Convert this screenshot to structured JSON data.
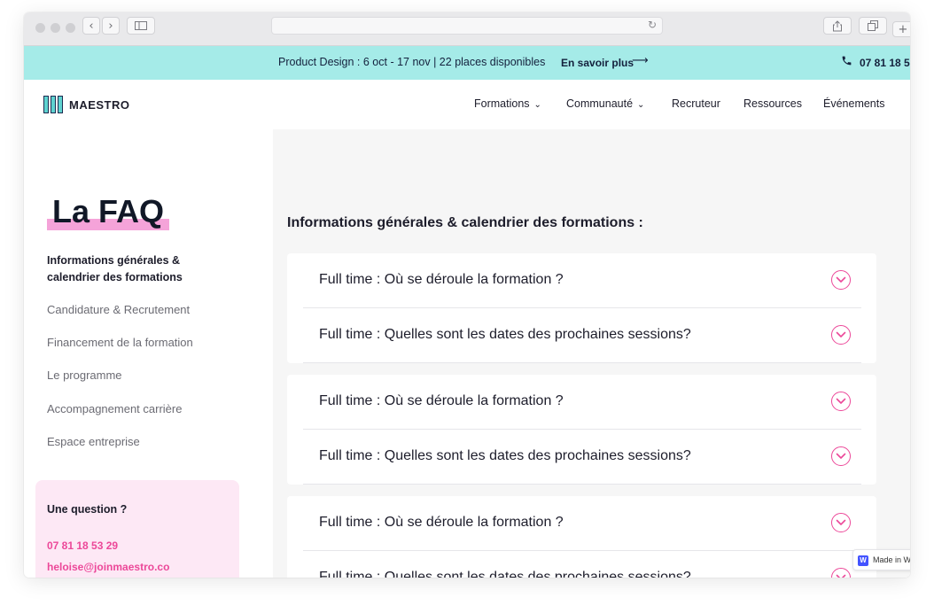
{
  "browser": {
    "reload_icon": "↻"
  },
  "promo_bar": {
    "text": "Product Design : 6 oct - 17 nov | 22 places disponibles",
    "link": "En savoir plus",
    "arrow": "⟶",
    "phone_icon": "phone-icon",
    "phone": "07 81 18 5"
  },
  "nav": {
    "logo": "MAESTRO",
    "items": [
      {
        "label": "Formations",
        "dropdown": true
      },
      {
        "label": "Communauté",
        "dropdown": true
      },
      {
        "label": "Recruteur",
        "dropdown": false
      },
      {
        "label": "Ressources",
        "dropdown": false
      },
      {
        "label": "Événements",
        "dropdown": false
      }
    ]
  },
  "sidebar": {
    "title": "La FAQ",
    "links": [
      {
        "label": "Informations générales & calendrier des formations",
        "active": true
      },
      {
        "label": "Candidature & Recrutement",
        "active": false
      },
      {
        "label": "Financement de la formation",
        "active": false
      },
      {
        "label": "Le programme",
        "active": false
      },
      {
        "label": "Accompagnement carrière",
        "active": false
      },
      {
        "label": "Espace entreprise",
        "active": false
      }
    ],
    "contact": {
      "title": "Une question ?",
      "phone": "07 81 18 53 29",
      "email": "heloise@joinmaestro.co"
    }
  },
  "main": {
    "heading": "Informations générales & calendrier des formations :",
    "cards": [
      {
        "questions": [
          "Full time : Où se déroule la formation ?",
          "Full time : Quelles sont les dates des prochaines sessions?"
        ]
      },
      {
        "questions": [
          "Full time : Où se déroule la formation ?",
          "Full time : Quelles sont les dates des prochaines sessions?"
        ]
      },
      {
        "questions": [
          "Full time : Où se déroule la formation ?",
          "Full time : Quelles sont les dates des prochaines sessions?"
        ]
      }
    ]
  },
  "badge": {
    "logo": "W",
    "text": "Made in Webflow"
  },
  "colors": {
    "promo_bg": "#a5ebe8",
    "accent_pink": "#ec4899",
    "highlight_pink": "#f5a3d9",
    "contact_bg": "#fde8f5",
    "main_bg": "#f6f6f6"
  }
}
